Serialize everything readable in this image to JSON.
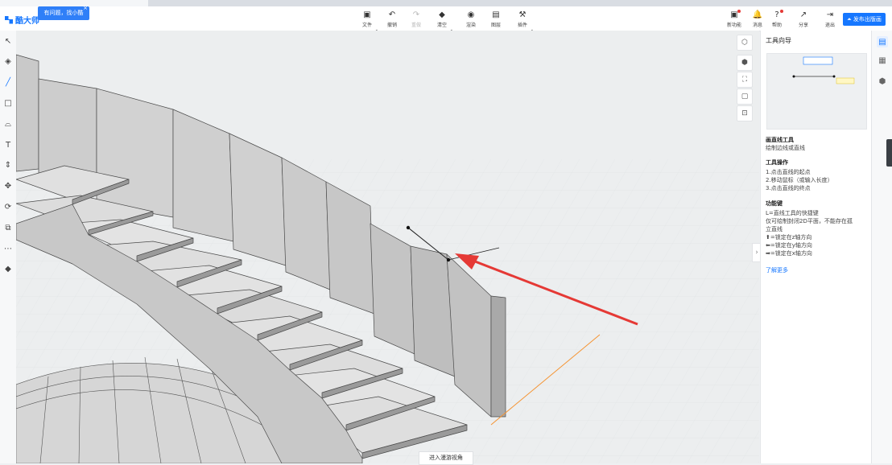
{
  "app": {
    "logo_text": "酷大师",
    "help_bubble": "有问题，找小酷",
    "help_close": "×",
    "publish_label": "发布出版画"
  },
  "toolbar": [
    {
      "label": "文件",
      "icon": "file-icon",
      "glyph": "▣",
      "dropdown": true
    },
    {
      "label": "撤销",
      "icon": "undo-icon",
      "glyph": "↶",
      "dropdown": false
    },
    {
      "label": "重做",
      "icon": "redo-icon",
      "glyph": "↷",
      "dropdown": false,
      "disabled": true
    },
    {
      "label": "清空",
      "icon": "clear-icon",
      "glyph": "◆",
      "dropdown": true
    },
    {
      "label": "渲染",
      "icon": "render-icon",
      "glyph": "◉",
      "dropdown": false
    },
    {
      "label": "图层",
      "icon": "layers-icon",
      "glyph": "▤",
      "dropdown": false
    },
    {
      "label": "插件",
      "icon": "plugin-icon",
      "glyph": "⚒",
      "dropdown": true
    }
  ],
  "header_right": [
    {
      "label": "新功能",
      "icon": "new-feature-icon",
      "glyph": "▣",
      "dot": true
    },
    {
      "label": "消息",
      "icon": "bell-icon",
      "glyph": "🔔",
      "dot": false
    },
    {
      "label": "帮助",
      "icon": "help-icon",
      "glyph": "?",
      "dot": true,
      "dropdown": true
    },
    {
      "label": "分享",
      "icon": "share-icon",
      "glyph": "↗",
      "dot": false
    },
    {
      "label": "退出",
      "icon": "logout-icon",
      "glyph": "⇥",
      "dot": false
    }
  ],
  "left_tools": [
    {
      "icon": "select-arrow-icon",
      "glyph": "↖"
    },
    {
      "icon": "paint-bucket-icon",
      "glyph": "◈"
    },
    {
      "icon": "line-tool-icon",
      "glyph": "╱",
      "active": true
    },
    {
      "icon": "rectangle-tool-icon",
      "glyph": "□"
    },
    {
      "icon": "arc-tool-icon",
      "glyph": "⌓"
    },
    {
      "icon": "text-tool-icon",
      "glyph": "T"
    },
    {
      "icon": "push-pull-icon",
      "glyph": "⇕"
    },
    {
      "icon": "move-tool-icon",
      "glyph": "✥"
    },
    {
      "icon": "rotate-tool-icon",
      "glyph": "⟳"
    },
    {
      "icon": "offset-tool-icon",
      "glyph": "⧉"
    },
    {
      "icon": "tape-measure-icon",
      "glyph": "⋯"
    },
    {
      "icon": "eraser-icon",
      "glyph": "◆"
    }
  ],
  "view_tools": [
    {
      "icon": "view-cube-icon",
      "glyph": "⬡"
    },
    {
      "icon": "perspective-icon",
      "glyph": "⬢"
    },
    {
      "icon": "zoom-extents-icon",
      "glyph": "⛶"
    },
    {
      "icon": "section-icon",
      "glyph": "▢"
    },
    {
      "icon": "zoom-window-icon",
      "glyph": "⊡"
    }
  ],
  "guide": {
    "title": "工具向导",
    "tool_name": "画直线工具",
    "tool_desc": "绘制边线或直线",
    "ops_title": "工具操作",
    "ops": [
      "1.点击直线的起点",
      "2.移动鼠标（或输入长度）",
      "3.点击直线的终点"
    ],
    "keys_title": "功能键",
    "keys": [
      "L=直线工具的快捷键",
      "仅可绘制封闭2D平面，不能存在孤",
      "立直线",
      "⬆=锁定在z轴方向",
      "⬅=锁定在y轴方向",
      "➡=锁定在x轴方向"
    ],
    "more_link": "了解更多"
  },
  "viewport": {
    "walk_mode_button": "进入漫游视角"
  },
  "right_tools": [
    {
      "icon": "tool-guide-icon",
      "glyph": "▤",
      "active": true
    },
    {
      "icon": "material-icon",
      "glyph": "▦"
    },
    {
      "icon": "component-icon",
      "glyph": "⬢"
    }
  ],
  "colors": {
    "accent": "#1677ff",
    "arrow": "#e53935",
    "axis_orange": "#f59331"
  }
}
